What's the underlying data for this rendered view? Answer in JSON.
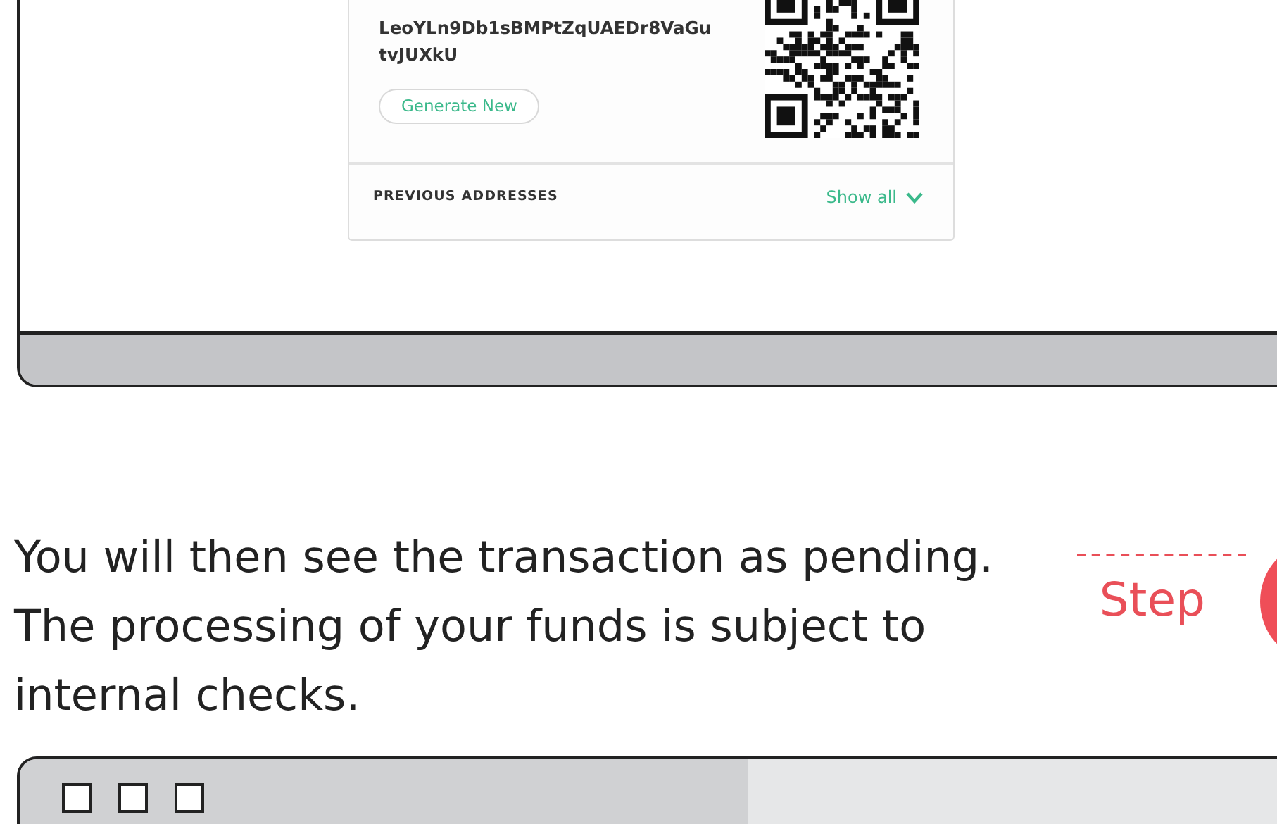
{
  "deposit_card": {
    "address": "LeoYLn9Db1sBMPtZqUAEDr8VaGutvJUXkU",
    "generate_button": "Generate New",
    "previous_heading": "PREVIOUS ADDRESSES",
    "show_all_link": "Show all"
  },
  "instruction": "You will then see the transaction as pending. The processing of your funds is subject to internal checks.",
  "step_label": "Step"
}
